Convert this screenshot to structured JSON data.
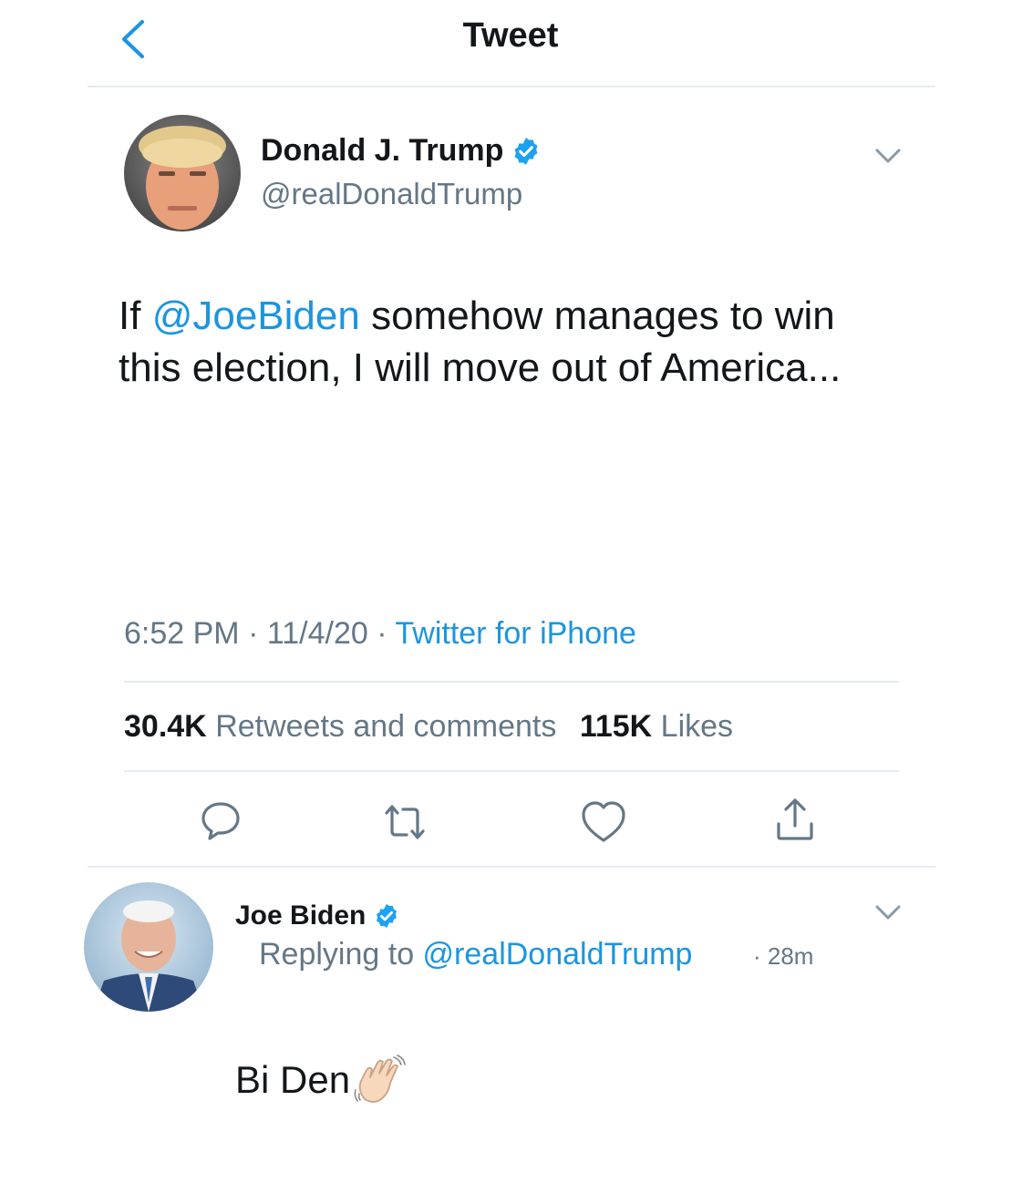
{
  "header": {
    "title": "Tweet",
    "back_icon": "chevron-left-icon"
  },
  "tweet": {
    "author": {
      "name": "Donald J. Trump",
      "handle": "@realDonaldTrump",
      "verified": true
    },
    "text": {
      "prefix": "If ",
      "mention": "@JoeBiden",
      "suffix": " somehow manages to win this election, I will move out of America..."
    },
    "meta": {
      "time": "6:52 PM",
      "sep1": " · ",
      "date": "11/4/20",
      "sep2": " · ",
      "source": "Twitter for iPhone"
    },
    "stats": {
      "retweets_count": "30.4K",
      "retweets_label": "Retweets and comments",
      "likes_count": "115K",
      "likes_label": "Likes"
    },
    "actions": [
      "reply-icon",
      "retweet-icon",
      "like-icon",
      "share-icon"
    ]
  },
  "reply": {
    "author": {
      "name": "Joe Biden",
      "verified": true
    },
    "replying_label": "Replying to ",
    "replying_handle": "@realDonaldTrump",
    "time": "· 28m",
    "text": "Bi Den",
    "emoji": "waving-hand-icon"
  },
  "colors": {
    "accent": "#1b95e0",
    "secondary_text": "#657786",
    "divider": "#e6ecf0"
  }
}
